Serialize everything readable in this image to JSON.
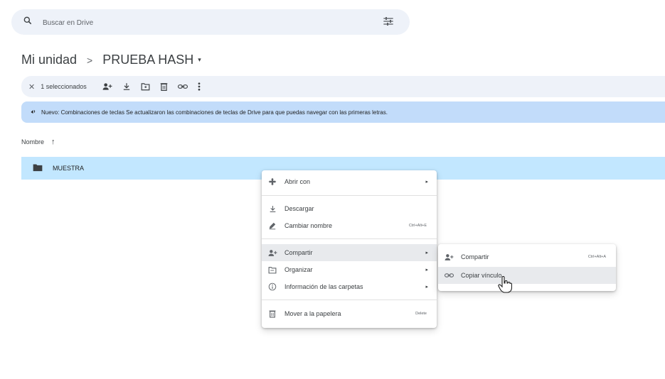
{
  "search": {
    "placeholder": "Buscar en Drive",
    "icon": "search-icon",
    "filter_icon": "filter-icon"
  },
  "breadcrumb": {
    "root": "Mi unidad",
    "separator": ">",
    "current": "PRUEBA HASH",
    "caret": "▾"
  },
  "selection_bar": {
    "close": "✕",
    "count": "1 seleccionados",
    "actions": [
      "share-icon",
      "download-icon",
      "move-icon",
      "trash-icon",
      "link-icon",
      "more-vert-icon"
    ]
  },
  "notice": {
    "text": "Nuevo: Combinaciones de teclas Se actualizaron las combinaciones de teclas de Drive para que puedas navegar con las primeras letras."
  },
  "column_header": {
    "label": "Nombre",
    "sort_arrow": "↑"
  },
  "rows": [
    {
      "name": "MUESTRA",
      "icon": "folder-icon"
    }
  ],
  "context_menu": {
    "open_with": "Abrir con",
    "download": "Descargar",
    "rename": "Cambiar nombre",
    "rename_shortcut": "Ctrl+Alt+E",
    "share": "Compartir",
    "organize": "Organizar",
    "folder_info": "Información de las carpetas",
    "trash": "Mover a la papelera",
    "trash_shortcut": "Delete",
    "chevron": "▸"
  },
  "submenu": {
    "share": "Compartir",
    "share_shortcut": "Ctrl+Alt+A",
    "copy_link": "Copiar vínculo"
  },
  "colors": {
    "selection": "#c2e7ff",
    "notice": "#c2dcfa",
    "bar": "#eef2f9",
    "hover": "#e8eaed"
  }
}
